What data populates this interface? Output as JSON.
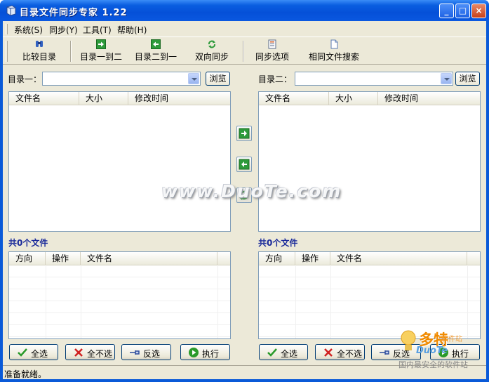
{
  "window": {
    "title": "目录文件同步专家 1.22",
    "minimize": "_",
    "maximize": "□",
    "close": "×"
  },
  "menu": [
    "系统(S)",
    "同步(Y)",
    "工具(T)",
    "帮助(H)"
  ],
  "toolbar": {
    "compare": "比较目录",
    "one_to_two": "目录一到二",
    "two_to_one": "目录二到一",
    "bidirectional": "双向同步",
    "sync_options": "同步选项",
    "same_file_search": "相同文件搜索"
  },
  "left": {
    "dir_label": "目录一：",
    "dir_value": "",
    "browse": "浏览",
    "columns": [
      "文件名",
      "大小",
      "修改时间"
    ],
    "count": "共0个文件",
    "op_columns": [
      "方向",
      "操作",
      "文件名"
    ],
    "select_all": "全选",
    "select_none": "全不选",
    "invert": "反选",
    "execute": "执行"
  },
  "right": {
    "dir_label": "目录二：",
    "dir_value": "",
    "browse": "浏览",
    "columns": [
      "文件名",
      "大小",
      "修改时间"
    ],
    "count": "共0个文件",
    "op_columns": [
      "方向",
      "操作",
      "文件名"
    ],
    "select_all": "全选",
    "select_none": "全不选",
    "invert": "反选",
    "execute": "执行"
  },
  "watermark": "www.DuoTe.com",
  "badge": {
    "name": "多特",
    "sub": "软件站",
    "en": "DuoTe",
    "tag": "国内最安全的软件站"
  },
  "status": "准备就绪。",
  "colors": {
    "title_bar": "#0550d8",
    "face": "#ece9d8",
    "count_text": "#1a2a9a",
    "list_border": "#7f9db9"
  }
}
